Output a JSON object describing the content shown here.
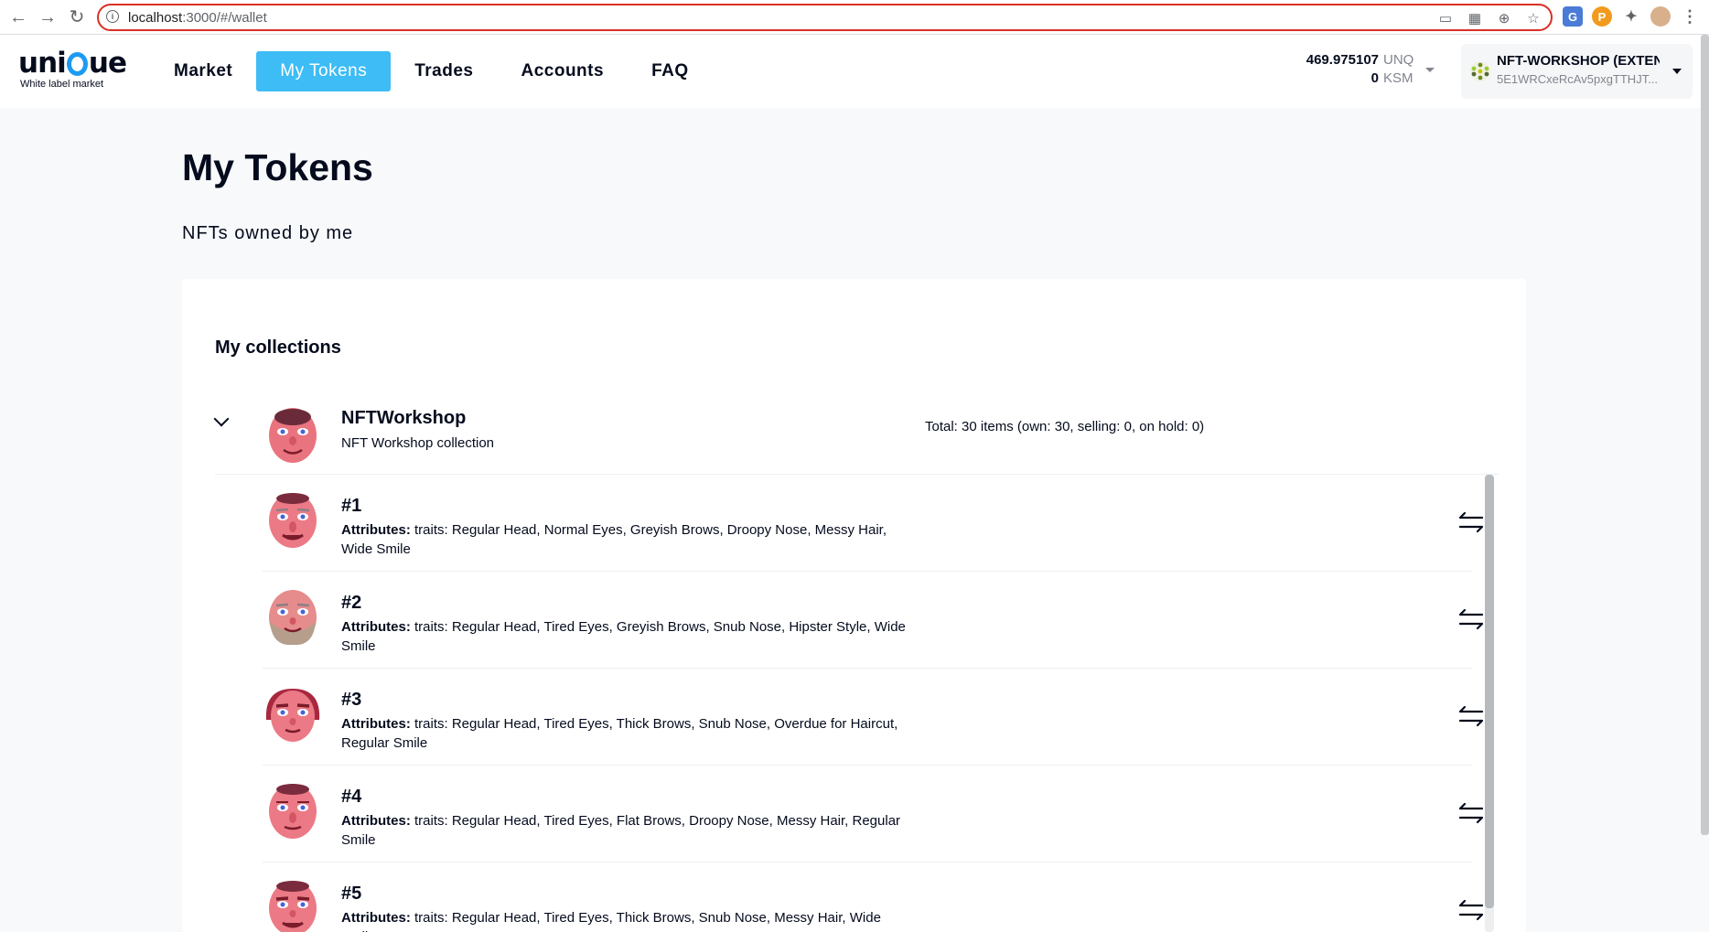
{
  "browser": {
    "url_host": "localhost",
    "url_path": ":3000/#/wallet"
  },
  "logo": {
    "left": "uni",
    "right": "ue",
    "subtitle": "White label market"
  },
  "nav": {
    "market": "Market",
    "my_tokens": "My Tokens",
    "trades": "Trades",
    "accounts": "Accounts",
    "faq": "FAQ"
  },
  "balance": {
    "unq_amount": "469.975107",
    "unq_label": "UNQ",
    "ksm_amount": "0",
    "ksm_label": "KSM"
  },
  "account": {
    "name": "NFT-WORKSHOP (EXTENSION)",
    "address": "5E1WRCxeRcAv5pxgTTHJT..."
  },
  "page": {
    "title": "My Tokens",
    "subtitle": "NFTs owned by me"
  },
  "collections": {
    "heading": "My collections",
    "items": [
      {
        "name": "NFTWorkshop",
        "description": "NFT Workshop collection",
        "total": "Total: 30 items (own: 30, selling: 0, on hold: 0)"
      }
    ]
  },
  "tokens": [
    {
      "id": "#1",
      "attr_label": "Attributes:",
      "attrs": "traits: Regular Head, Normal Eyes, Greyish Brows, Droopy Nose, Messy Hair, Wide Smile"
    },
    {
      "id": "#2",
      "attr_label": "Attributes:",
      "attrs": "traits: Regular Head, Tired Eyes, Greyish Brows, Snub Nose, Hipster Style, Wide Smile"
    },
    {
      "id": "#3",
      "attr_label": "Attributes:",
      "attrs": "traits: Regular Head, Tired Eyes, Thick Brows, Snub Nose, Overdue for Haircut, Regular Smile"
    },
    {
      "id": "#4",
      "attr_label": "Attributes:",
      "attrs": "traits: Regular Head, Tired Eyes, Flat Brows, Droopy Nose, Messy Hair, Regular Smile"
    },
    {
      "id": "#5",
      "attr_label": "Attributes:",
      "attrs": "traits: Regular Head, Tired Eyes, Thick Brows, Snub Nose, Messy Hair, Wide Smile"
    }
  ],
  "colors": {
    "accent": "#3dbcf6",
    "logo_blue": "#1d9bf0",
    "text_dark": "#040b1d",
    "text_muted": "#81858e",
    "page_bg": "#f8f9fa"
  }
}
